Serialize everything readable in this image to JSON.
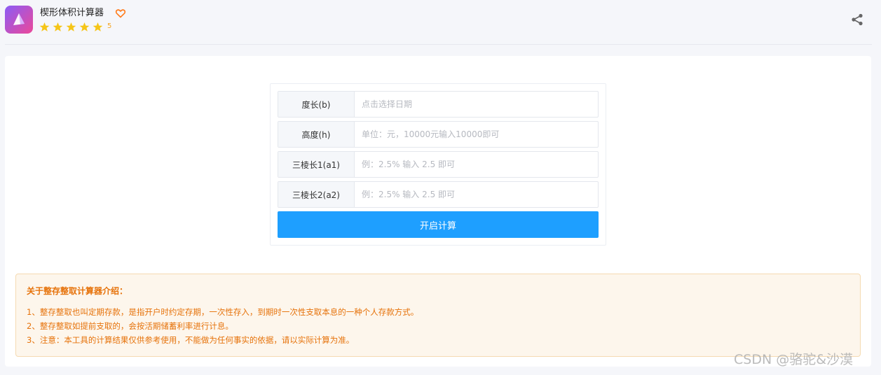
{
  "app": {
    "title": "楔形体积计算器",
    "rating_value": "5",
    "rating_stars": 5
  },
  "form": {
    "rows": [
      {
        "label": "度长(b)",
        "placeholder": "点击选择日期"
      },
      {
        "label": "高度(h)",
        "placeholder": "单位：元，10000元输入10000即可"
      },
      {
        "label": "三棱长1(a1)",
        "placeholder": "例：2.5% 输入 2.5 即可"
      },
      {
        "label": "三棱长2(a2)",
        "placeholder": "例：2.5% 输入 2.5 即可"
      }
    ],
    "submit_label": "开启计算"
  },
  "notice": {
    "title": "关于整存整取计算器介绍：",
    "items": [
      "1、整存整取也叫定期存款，是指开户时约定存期，一次性存入，到期时一次性支取本息的一种个人存款方式。",
      "2、整存整取如提前支取的，会按活期储蓄利率进行计息。",
      "3、注意：本工具的计算结果仅供参考使用，不能做为任何事实的依据，请以实际计算为准。"
    ]
  },
  "watermark": "CSDN @骆驼&沙漠",
  "icons": {
    "logo": "app-logo-icon",
    "favorite": "heart-icon",
    "star": "star-icon",
    "share": "share-icon"
  },
  "colors": {
    "primary_button": "#1e9fff",
    "star": "#f5c518",
    "notice_text": "#e6720a",
    "notice_bg": "#fdf6ec",
    "notice_border": "#f5dab1"
  }
}
